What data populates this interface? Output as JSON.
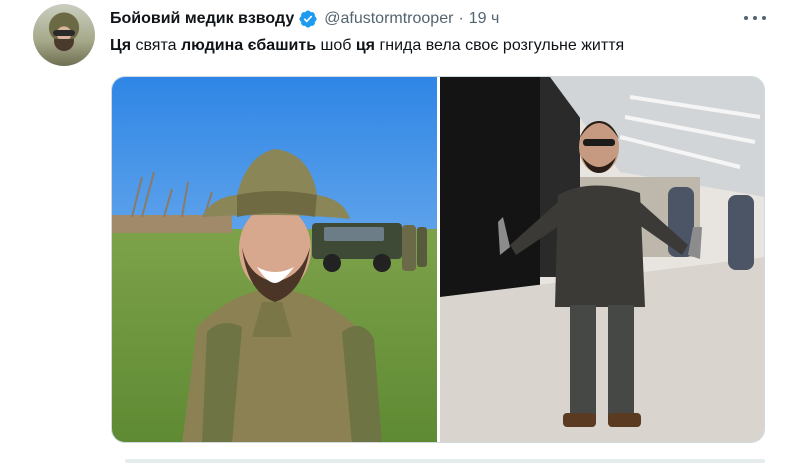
{
  "tweet": {
    "author_name": "Бойовий медик взводу",
    "handle": "@afustormtrooper",
    "separator": "·",
    "time_ago": "19 ч",
    "text_segments": [
      {
        "text": "Ця",
        "bold": true
      },
      {
        "text": " свята ",
        "bold": false
      },
      {
        "text": "людина єбашить",
        "bold": true
      },
      {
        "text": " шоб ",
        "bold": false
      },
      {
        "text": "ця",
        "bold": true
      },
      {
        "text": " гнида вела своє розгульне життя",
        "bold": false
      }
    ]
  },
  "icons": {
    "verified": "verified-badge-icon",
    "more": "more-options-icon"
  },
  "colors": {
    "verified_blue": "#1d9bf0",
    "secondary_text": "#536471",
    "primary_text": "#0f1419"
  },
  "media": {
    "count": 2,
    "items": [
      {
        "name": "soldier-photo",
        "description_icon": "photo"
      },
      {
        "name": "man-with-knives-photo",
        "description_icon": "photo"
      }
    ]
  }
}
